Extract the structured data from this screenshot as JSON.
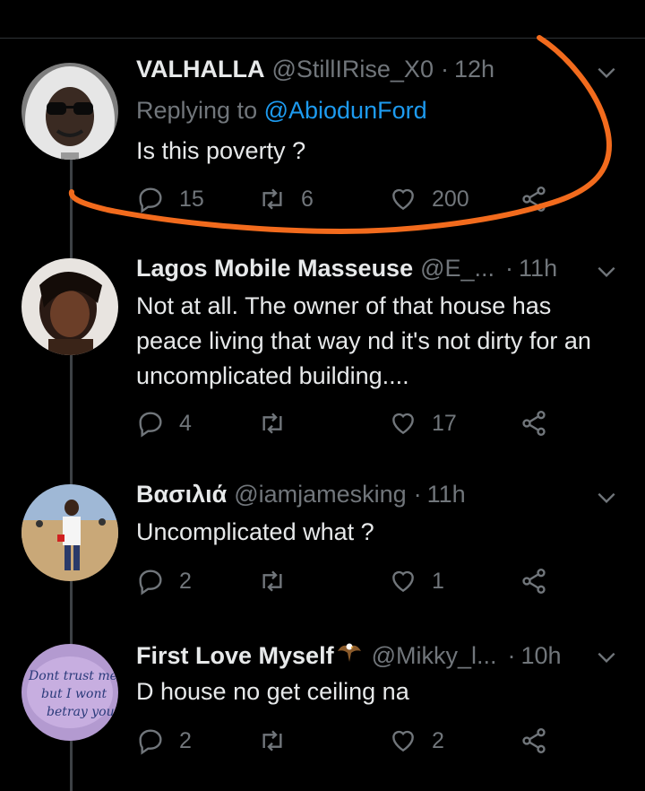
{
  "tweets": [
    {
      "name": "VALHALLA",
      "handle": "@StillIRise_X0",
      "time": "12h",
      "reply_prefix": "Replying to ",
      "reply_to": "@AbiodunFord",
      "text": "Is this poverty ?",
      "replies": "15",
      "retweets": "6",
      "likes": "200"
    },
    {
      "name": "Lagos Mobile Masseuse",
      "handle": "@E_...",
      "time": "11h",
      "text": "Not at all.  The owner of that house has peace living that way nd it's not dirty for an uncomplicated building....",
      "replies": "4",
      "retweets": "",
      "likes": "17"
    },
    {
      "name": "Βασιλιά",
      "handle": "@iamjamesking",
      "time": "11h",
      "text": "Uncomplicated what ?",
      "replies": "2",
      "retweets": "",
      "likes": "1"
    },
    {
      "name": "First Love Myself",
      "handle": "@Mikky_l...",
      "time": "10h",
      "text": "D house no get ceiling na",
      "replies": "2",
      "retweets": "",
      "likes": "2",
      "avatar_tattoo_text": "Dont trust me but I wont betray you"
    }
  ],
  "colors": {
    "accent": "#1d9bf0",
    "annotation": "#f26b1d",
    "muted": "#71767b"
  },
  "icons": [
    "reply-icon",
    "retweet-icon",
    "like-icon",
    "share-icon",
    "chevron-down-icon",
    "eagle-emoji-icon"
  ]
}
